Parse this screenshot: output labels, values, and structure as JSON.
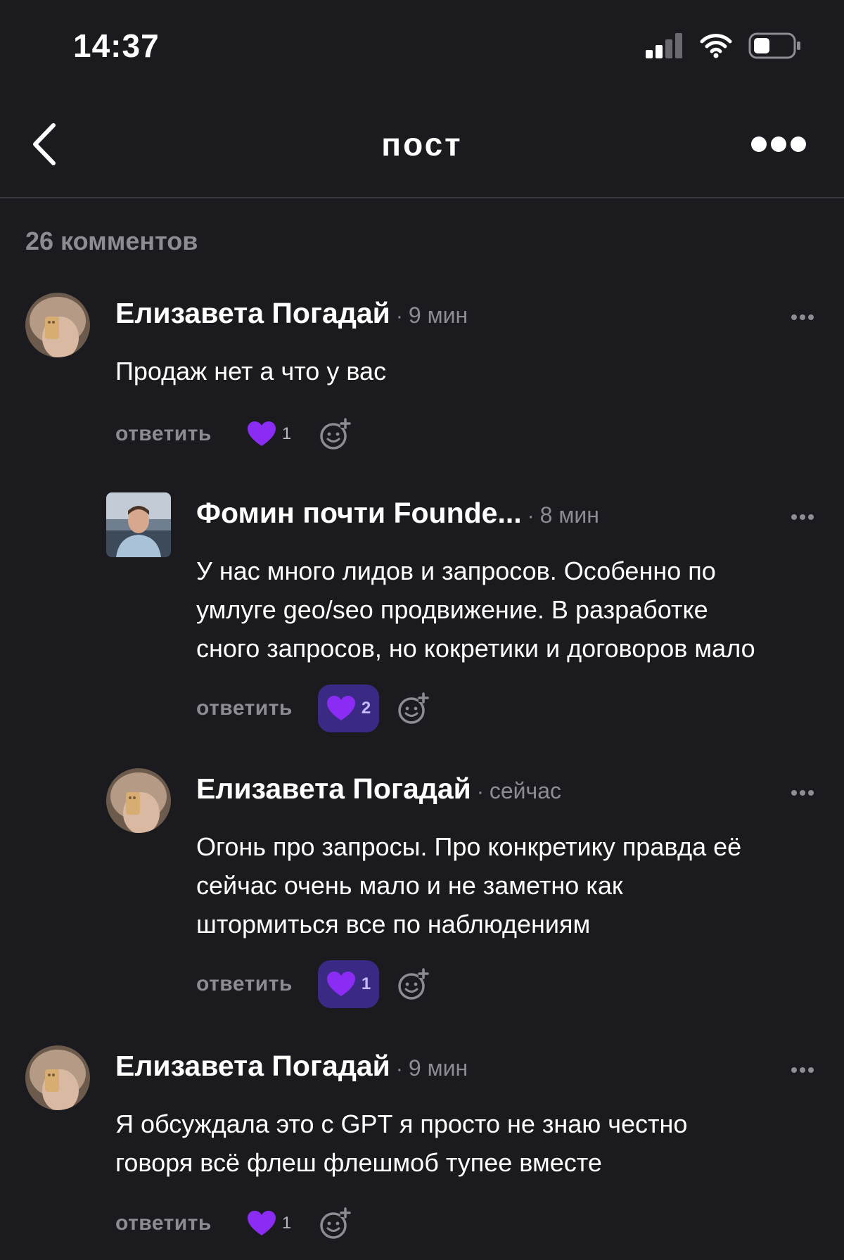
{
  "status_bar": {
    "time": "14:37"
  },
  "header": {
    "title": "пост"
  },
  "comments_count": "26 комментов",
  "comments": [
    {
      "author": "Елизавета Погадай",
      "time": "9 мин",
      "text_lines": [
        "Продаж нет а что у вас"
      ],
      "reply_label": "ответить",
      "likes": "1",
      "liked": false
    },
    {
      "author": "Фомин почти Founde...",
      "time": "8 мин",
      "text_lines": [
        "У нас много лидов и запросов. Особенно по",
        "умлуге geo/seo продвижение. В разработке",
        "сного запросов, но кокретики и договоров мало"
      ],
      "reply_label": "ответить",
      "likes": "2",
      "liked": true
    },
    {
      "author": "Елизавета Погадай",
      "time": "сейчас",
      "text_lines": [
        "Огонь про запросы. Про конкретику правда её",
        "сейчас очень мало и не заметно как",
        "штормиться все по наблюдениям"
      ],
      "reply_label": "ответить",
      "likes": "1",
      "liked": true
    },
    {
      "author": "Елизавета Погадай",
      "time": "9 мин",
      "text_lines": [
        "Я обсуждала это с GPT я просто не знаю честно",
        "говоря всё флеш флешмоб тупее вместе"
      ],
      "reply_label": "ответить",
      "likes": "1",
      "liked": false
    }
  ],
  "colors": {
    "background": "#1b1a1f",
    "heart": "#8b2cf5",
    "active_like_bg": "#3b2a84",
    "muted_text": "#8d8c93"
  },
  "icons": {
    "back": "chevron-left-icon",
    "more": "ellipsis-icon",
    "like": "heart-icon",
    "react": "add-reaction-icon",
    "signal": "signal-icon",
    "wifi": "wifi-icon",
    "battery": "battery-icon"
  }
}
